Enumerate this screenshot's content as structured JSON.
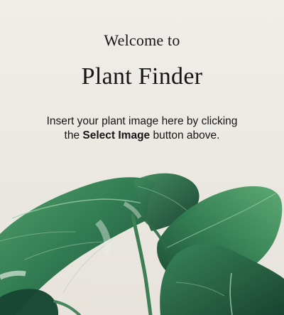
{
  "welcome": {
    "eyebrow": "Welcome to",
    "title": "Plant Finder"
  },
  "instructions": {
    "line1": "Insert your plant image here by clicking",
    "line2_before": "the ",
    "button_reference": "Select Image",
    "line2_after": " button above."
  },
  "colors": {
    "background": "#eeebe5",
    "text": "#161616",
    "leaf_dark": "#123f2e",
    "leaf_mid": "#2d7f52",
    "leaf_light": "#5aa871"
  },
  "image": {
    "subject": "monstera-leaves"
  }
}
